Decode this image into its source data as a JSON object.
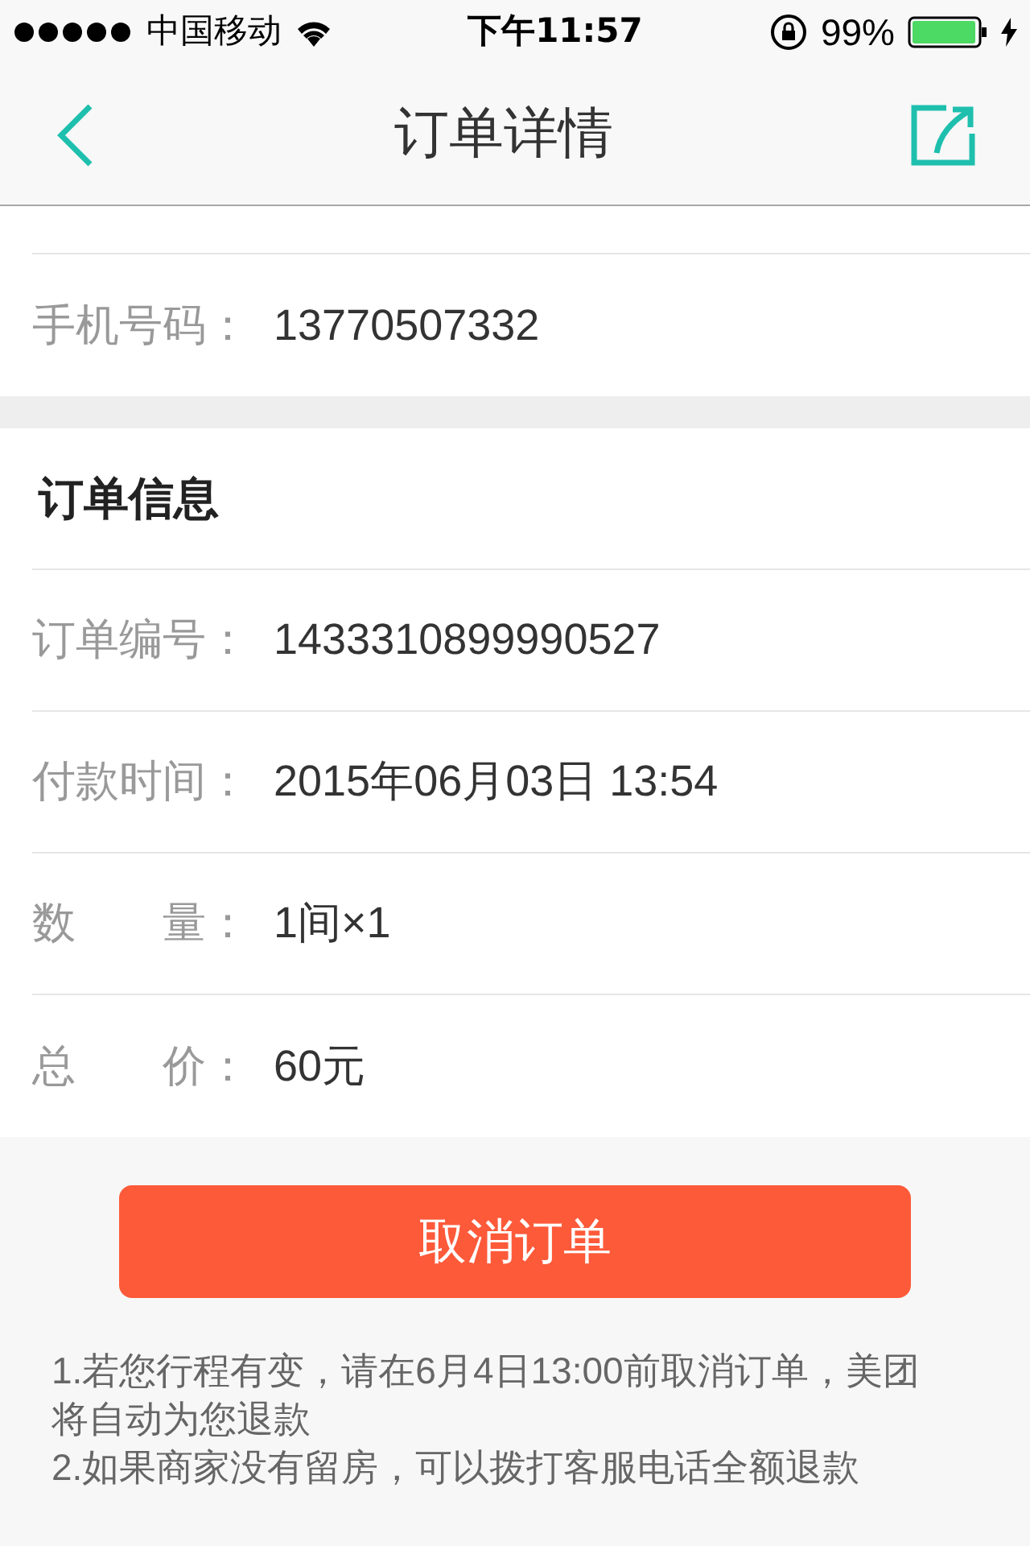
{
  "status_bar": {
    "carrier": "中国移动",
    "time": "下午11:57",
    "battery": "99%"
  },
  "nav": {
    "title": "订单详情"
  },
  "contact": {
    "rows": [
      {
        "label": "手机号码：",
        "value": "13770507332"
      }
    ]
  },
  "order": {
    "heading": "订单信息",
    "rows": [
      {
        "label": "订单编号：",
        "value": "1433310899990527"
      },
      {
        "label": "付款时间：",
        "value": "2015年06月03日 13:54"
      },
      {
        "label": "数　　量：",
        "value": "1间×1"
      },
      {
        "label": "总　　价：",
        "value": "60元"
      }
    ]
  },
  "cancel_button": "取消订单",
  "notes": [
    "1.若您行程有变，请在6月4日13:00前取消订单，美团将自动为您退款",
    "2.如果商家没有留房，可以拨打客服电话全额退款"
  ]
}
